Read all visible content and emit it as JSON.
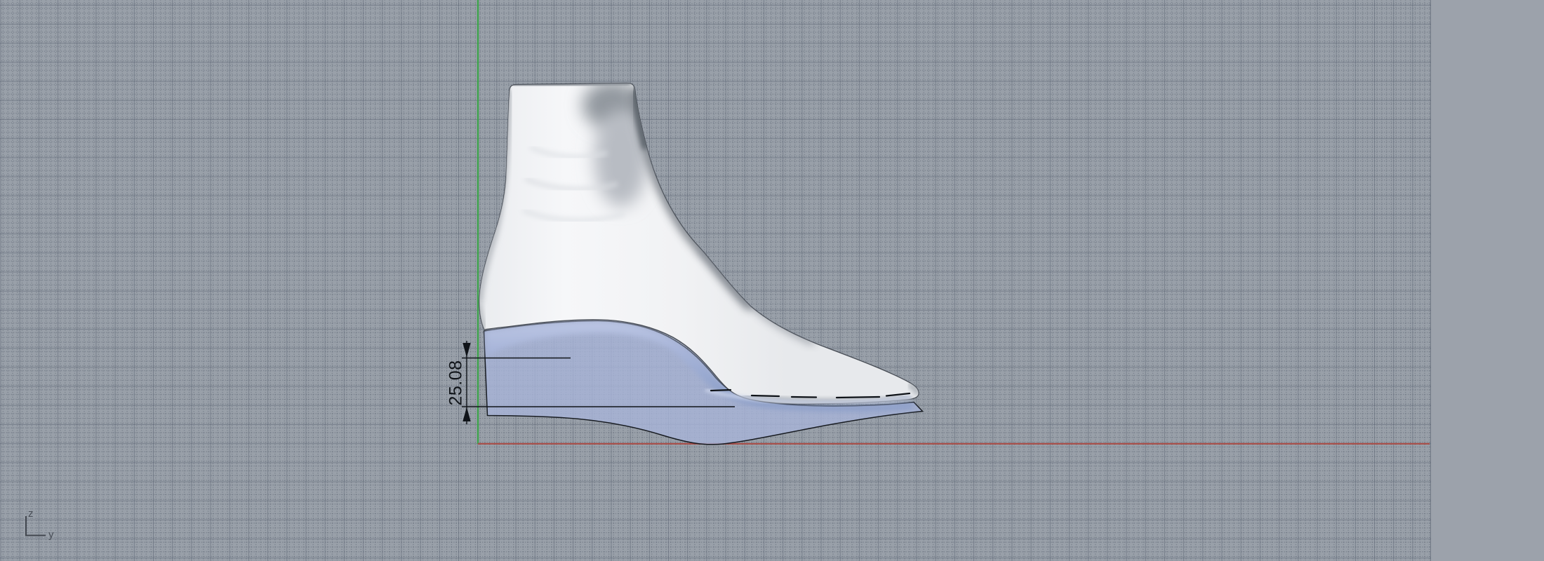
{
  "viewport": {
    "dimension": {
      "value": "25.08"
    },
    "axis_gizmo": {
      "z_label": "z",
      "y_label": "y"
    },
    "colors": {
      "background": "#9CA2AB",
      "grid_background": "#99A0A9",
      "grid_major_line": "#848C98",
      "z_axis_green": "#3EA34C",
      "y_axis_red": "#A84B45",
      "sole_flat_blue": "#A7B4D8",
      "sole_shaded_blue": "#8C9FC9",
      "foot_model_white": "#F2F3F5",
      "annotation_black": "#101419"
    }
  }
}
